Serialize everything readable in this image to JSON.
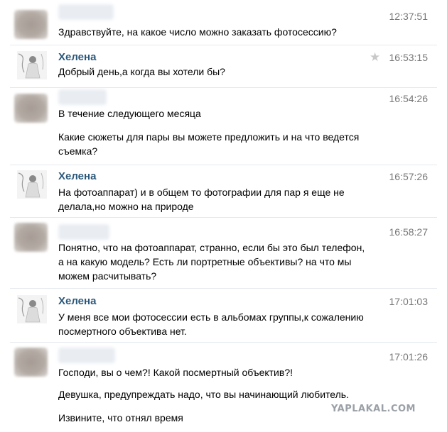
{
  "messages": [
    {
      "author": "",
      "time": "12:37:51",
      "lines": [
        "Здравствуйте, на какое число можно заказать фотосессию?"
      ]
    },
    {
      "author": "Хелена",
      "time": "16:53:15",
      "lines": [
        "Добрый день,а когда вы хотели бы?"
      ]
    },
    {
      "author": "",
      "time": "16:54:26",
      "lines": [
        "В течение следующего месяца",
        "Какие сюжеты для пары вы можете предложить и на что ведется съемка?"
      ]
    },
    {
      "author": "Хелена",
      "time": "16:57:26",
      "lines": [
        "На фотоаппарат) и в общем то фотографии для пар я еще не делала,но можно на природе"
      ]
    },
    {
      "author": "",
      "time": "16:58:27",
      "lines": [
        "Понятно, что на фотоаппарат, странно, если бы это был телефон, а на какую модель? Есть ли портретные объективы? на что мы можем расчитывать?"
      ]
    },
    {
      "author": "Хелена",
      "time": "17:01:03",
      "lines": [
        "У меня все мои фотосессии есть в альбомах группы,к сожалению посмертного объектива нет."
      ]
    },
    {
      "author": "",
      "time": "17:01:26",
      "lines": [
        "Господи, вы о чем?! Какой посмертный объектив?!",
        "Девушка, предупреждать надо, что вы начинающий любитель.",
        "Извините, что отнял время"
      ]
    }
  ],
  "icons": {
    "star": "star-icon"
  },
  "watermark": "YAPLAKAL.COM"
}
